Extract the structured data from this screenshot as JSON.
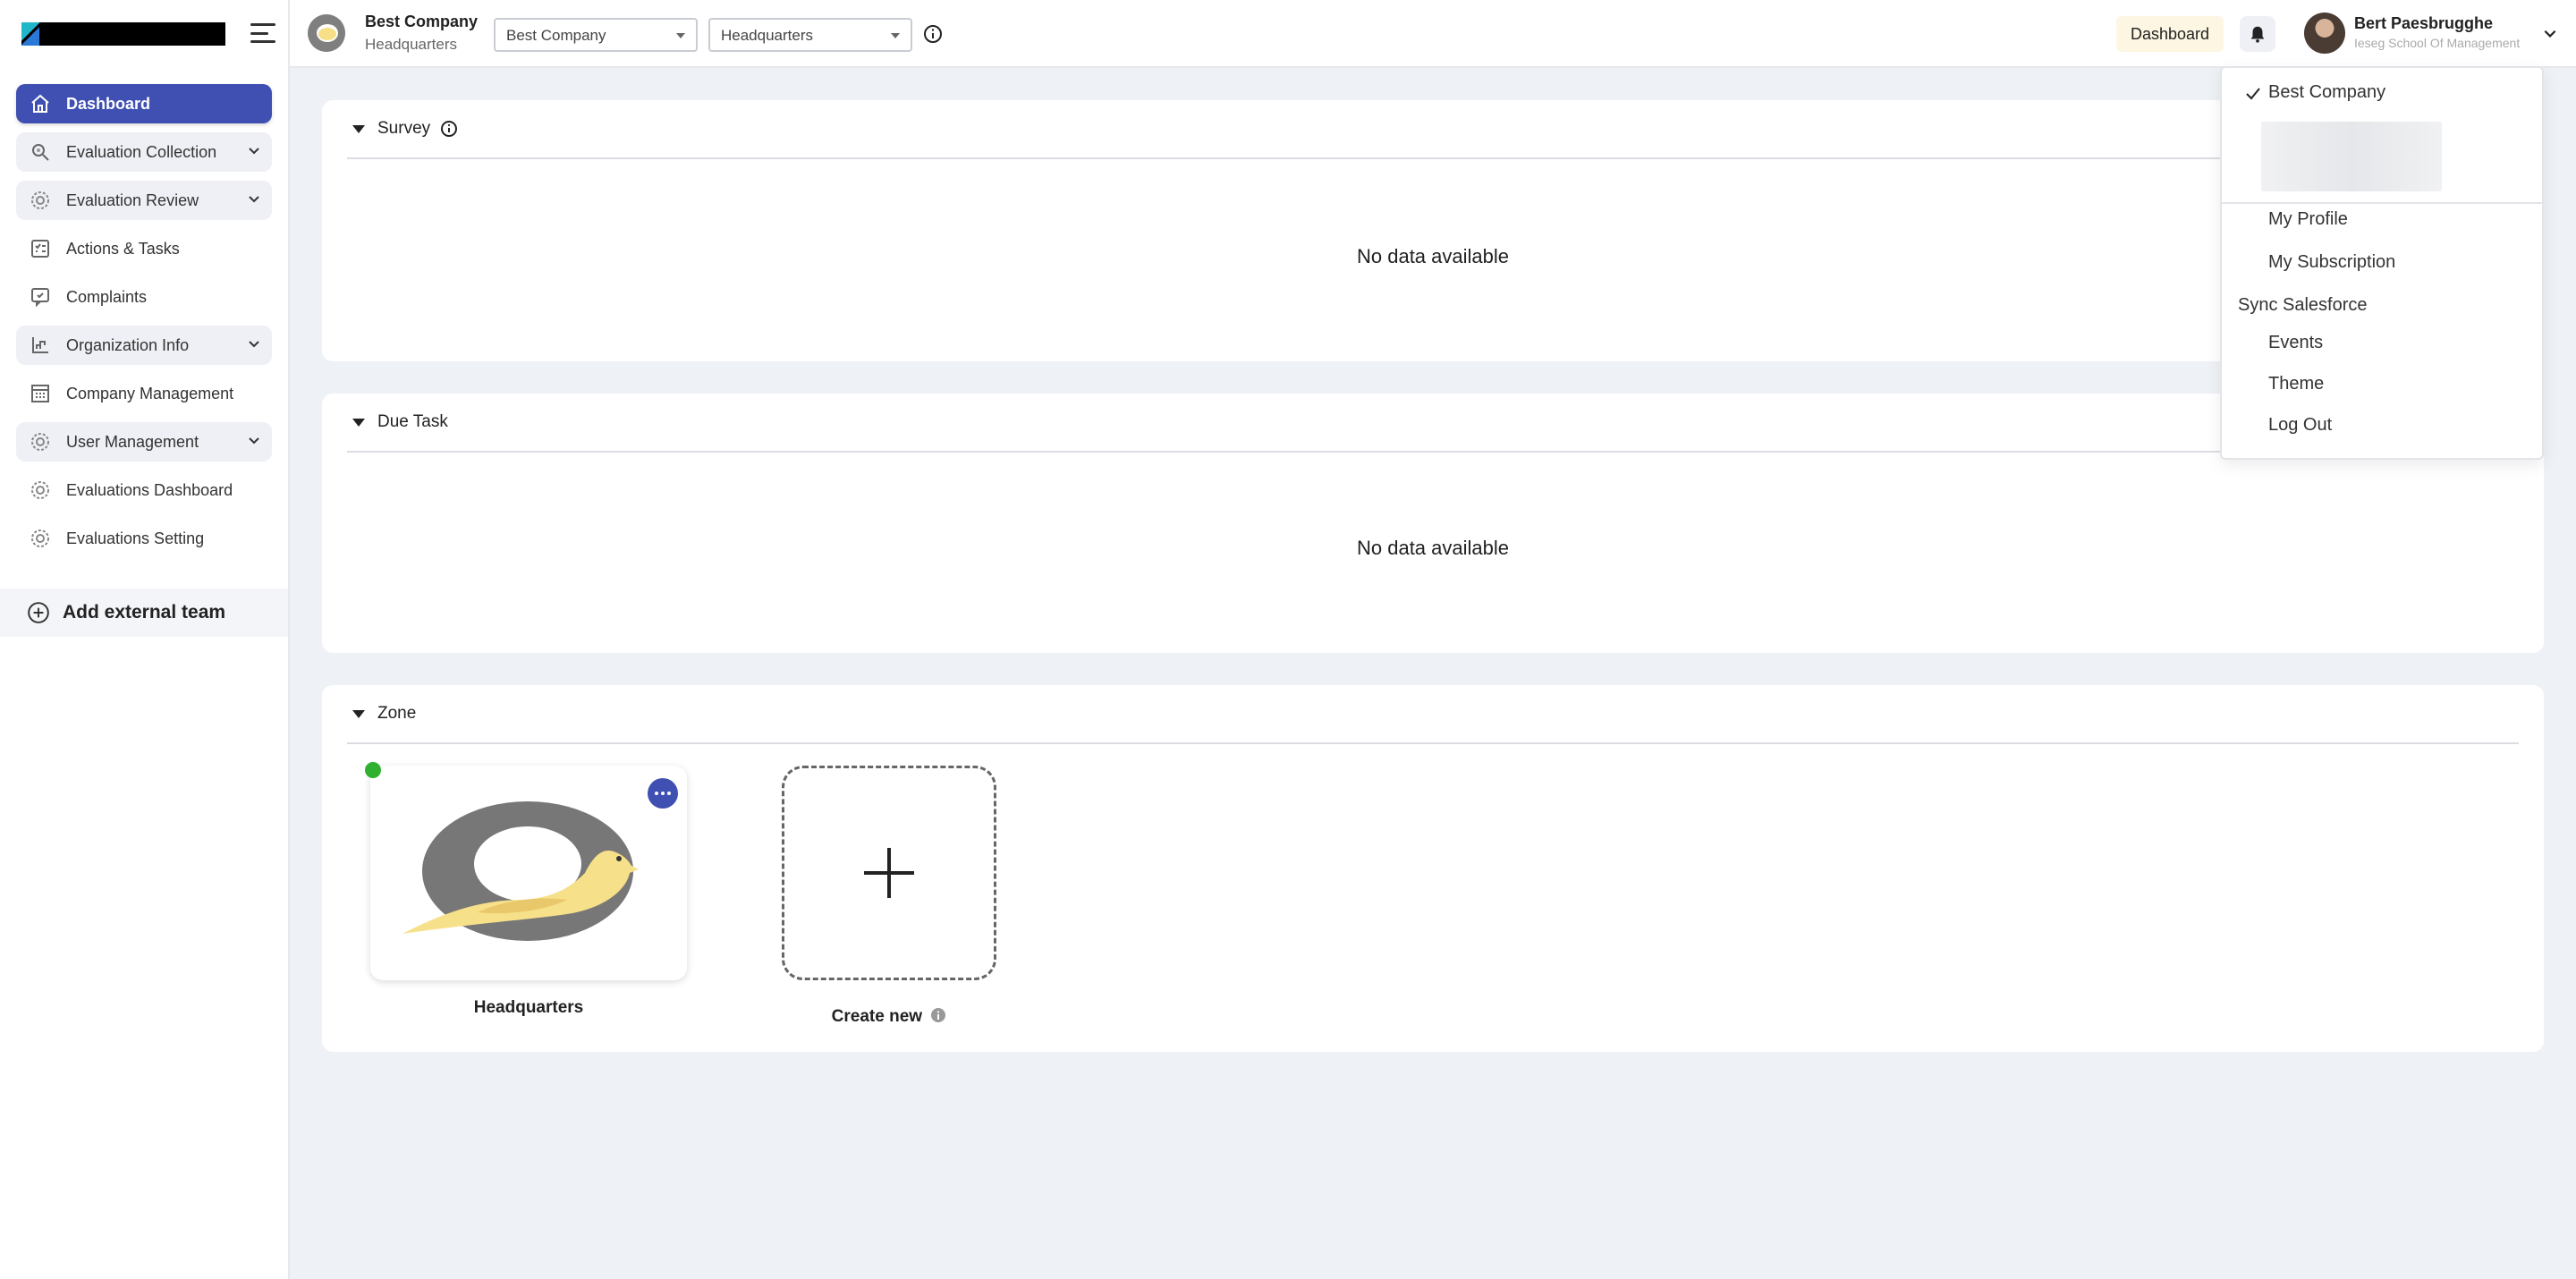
{
  "sidebar": {
    "items": [
      {
        "label": "Dashboard",
        "icon": "home-icon"
      },
      {
        "label": "Evaluation Collection",
        "icon": "magnifier-icon"
      },
      {
        "label": "Evaluation Review",
        "icon": "gear-icon"
      },
      {
        "label": "Actions & Tasks",
        "icon": "checklist-icon"
      },
      {
        "label": "Complaints",
        "icon": "complaint-icon"
      },
      {
        "label": "Organization Info",
        "icon": "org-chart-icon"
      },
      {
        "label": "Company Management",
        "icon": "building-icon"
      },
      {
        "label": "User Management",
        "icon": "gear-icon"
      },
      {
        "label": "Evaluations Dashboard",
        "icon": "gear-icon"
      },
      {
        "label": "Evaluations Setting",
        "icon": "gear-icon"
      }
    ],
    "add_team_label": "Add external team"
  },
  "header": {
    "company_name": "Best Company",
    "company_sub": "Headquarters",
    "company_select": "Best Company",
    "location_select": "Headquarters",
    "dashboard_chip": "Dashboard",
    "user_name": "Bert Paesbrugghe",
    "user_org": "Ieseg School Of Management"
  },
  "main": {
    "survey": {
      "title": "Survey",
      "empty": "No data available"
    },
    "due_task": {
      "title": "Due Task",
      "empty": "No data available"
    },
    "zone": {
      "title": "Zone",
      "tiles": [
        {
          "label": "Headquarters",
          "status": "active"
        }
      ],
      "create_label": "Create new"
    }
  },
  "dropdown": {
    "selected_company": "Best Company",
    "items": [
      "My Profile",
      "My Subscription"
    ],
    "section_label": "Sync Salesforce",
    "section_items": [
      "Events",
      "Theme",
      "Log Out"
    ]
  },
  "colors": {
    "accent": "#3f4fb2",
    "status_active": "#2fb12f",
    "chip_bg": "#fdf6e2"
  }
}
